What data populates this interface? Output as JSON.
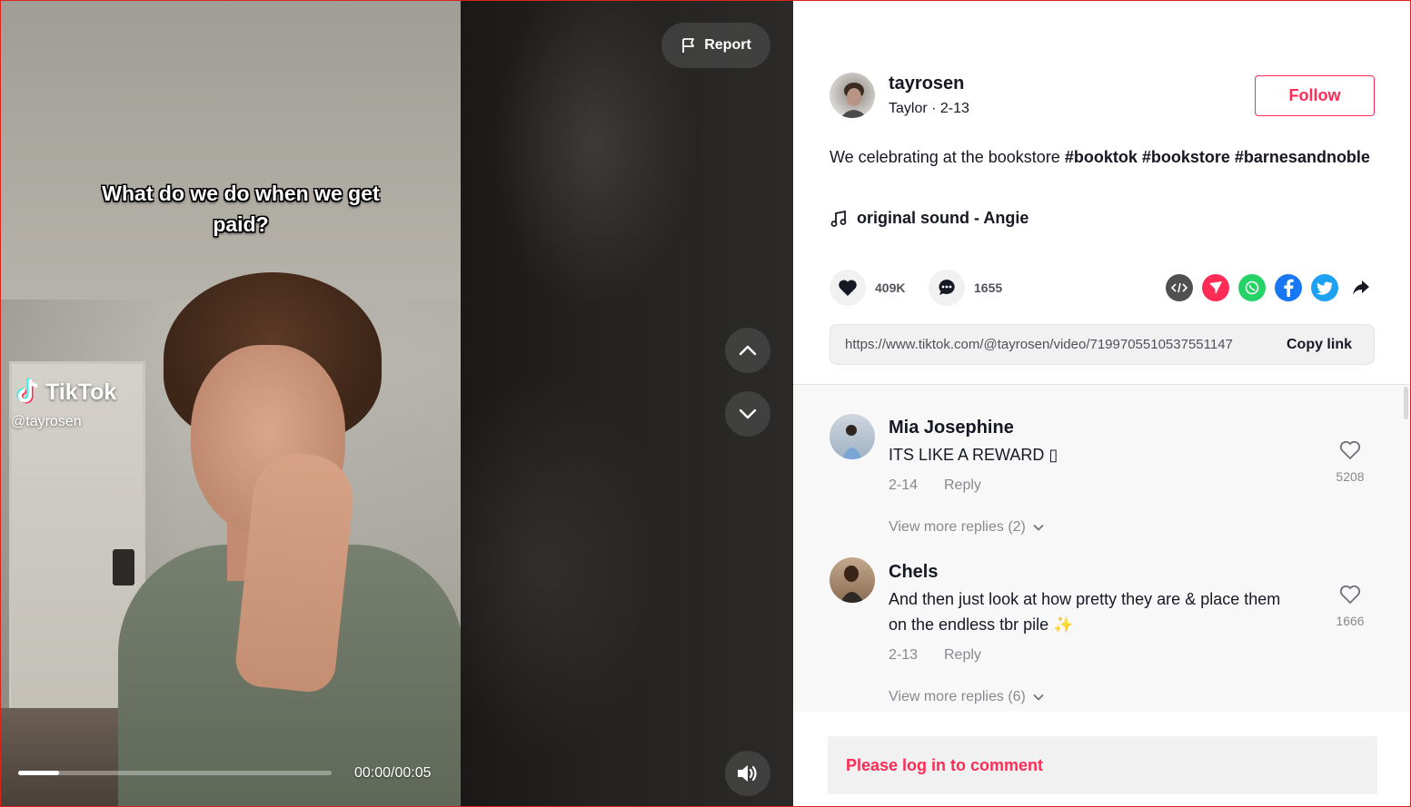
{
  "video": {
    "caption": "What do we do when we get paid?",
    "watermark_brand": "TikTok",
    "watermark_handle": "@tayrosen",
    "time": "00:00/00:05",
    "progress": 0.13,
    "report_label": "Report"
  },
  "author": {
    "username": "tayrosen",
    "subline": "Taylor · 2-13",
    "follow_label": "Follow"
  },
  "description": {
    "text": "We celebrating at the bookstore ",
    "tags": [
      "#booktok",
      "#bookstore",
      "#barnesandnoble"
    ]
  },
  "music": "original sound - Angie",
  "actions": {
    "likes": "409K",
    "comments": "1655"
  },
  "share_icons": [
    "embed-icon",
    "send-to-friends-icon",
    "whatsapp-icon",
    "facebook-icon",
    "twitter-icon",
    "share-arrow-icon"
  ],
  "link": {
    "url": "https://www.tiktok.com/@tayrosen/video/7199705510537551147",
    "copy_label": "Copy link"
  },
  "comments": [
    {
      "name": "Mia Josephine",
      "text": "ITS LIKE A REWARD ▯",
      "date": "2-14",
      "reply": "Reply",
      "likes": "5208",
      "more": "View more replies (2)"
    },
    {
      "name": "Chels",
      "text": "And then just look at how pretty they are & place them on the endless tbr pile ✨",
      "date": "2-13",
      "reply": "Reply",
      "likes": "1666",
      "more": "View more replies (6)"
    }
  ],
  "login_prompt": "Please log in to comment",
  "colors": {
    "accent": "#fe2c55",
    "text": "#161823",
    "video_bg": "#1e1d1c"
  }
}
